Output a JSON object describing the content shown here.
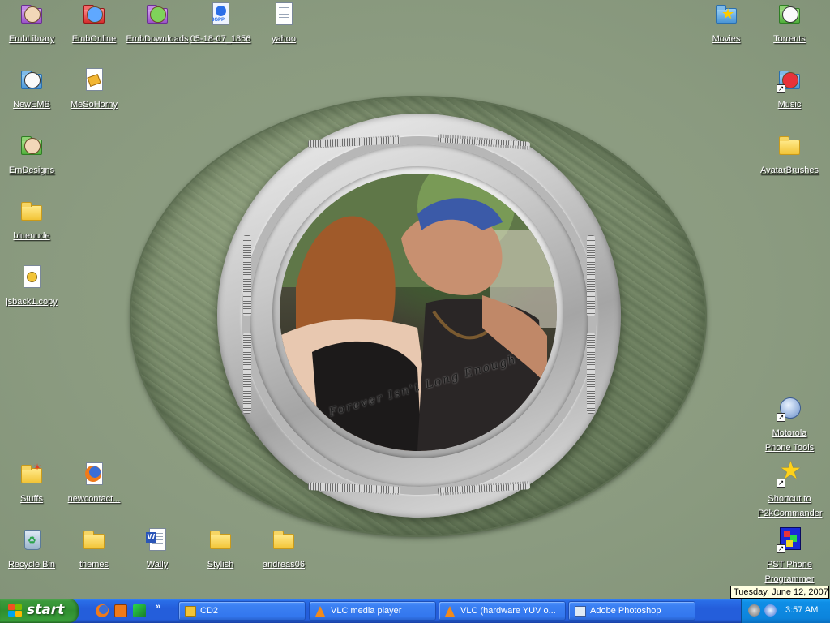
{
  "desktop": {
    "wallpaper_caption": "Forever Isn't Long Enough",
    "icons": {
      "emblibrary": "EmbLibrary",
      "emblonline": "EmbOnline",
      "embdownloads": "EmbDownloads",
      "file_3gpp": "05-18-07_1856",
      "yahoo": "yahoo",
      "movies": "Movies",
      "torrents": "Torrents",
      "newemb": "NewEMB",
      "mesohorny": "MeSoHorny",
      "music": "Music",
      "emdesigns": "EmDesigns",
      "avatarbrushes": "AvatarBrushes",
      "bluenude": "bluenude",
      "jsback": "jsback1.copy",
      "motorola_line1": "Motorola",
      "motorola_line2": "Phone Tools",
      "stuffs": "Stuffs",
      "newcontact": "newcontact...",
      "p2k_line1": "Shortcut to",
      "p2k_line2": "P2kCommander",
      "recycle": "Recycle Bin",
      "themes": "themes",
      "wally": "Wally",
      "stylish": "Stylish",
      "andreas": "andreas06",
      "pst_line1": "PST Phone",
      "pst_line2": "Programmer"
    },
    "icon_names": {
      "file_3gpp_badge": "3GPP"
    }
  },
  "tooltip": {
    "date": "Tuesday, June 12, 2007"
  },
  "taskbar": {
    "start_label": "start",
    "quicklaunch_more": "»",
    "tasks": [
      {
        "label": "CD2"
      },
      {
        "label": "VLC media player"
      },
      {
        "label": "VLC (hardware YUV o..."
      },
      {
        "label": "Adobe Photoshop"
      }
    ],
    "clock": "3:57 AM"
  },
  "colors": {
    "taskbar": "#245edb",
    "start": "#3c9a3c",
    "tray": "#0c84dc",
    "desktop": "#8b9b80"
  }
}
